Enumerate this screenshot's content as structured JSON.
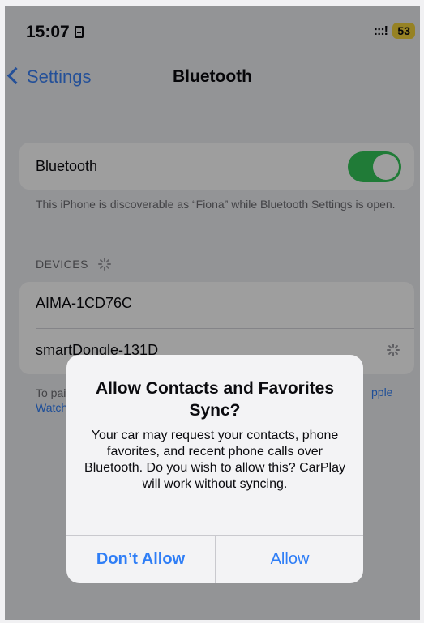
{
  "status_bar": {
    "time": "15:07",
    "signal": ":::!",
    "battery": "53"
  },
  "nav": {
    "back_label": "Settings",
    "title": "Bluetooth"
  },
  "bluetooth_group": {
    "toggle_label": "Bluetooth",
    "toggle_on": true,
    "discoverable_note": "This iPhone is discoverable as “Fiona” while Bluetooth Settings is open."
  },
  "devices": {
    "header": "DEVICES",
    "items": [
      {
        "name": "AIMA-1CD76C"
      },
      {
        "name": "smartDongle-131D"
      }
    ],
    "footer_left": "To pai",
    "footer_left_2": "Watch",
    "footer_right": "pple"
  },
  "alert": {
    "title": "Allow Contacts and Favorites Sync?",
    "message": "Your car may request your contacts, phone favorites, and recent phone calls over Bluetooth. Do you wish to allow this? CarPlay will work without syncing.",
    "deny_label": "Don’t Allow",
    "allow_label": "Allow"
  },
  "colors": {
    "accent": "#2f7ef6",
    "toggle_on": "#35c759",
    "battery": "#f2d23a"
  },
  "icons": [
    "sim-card-icon",
    "signal-icon",
    "chevron-left-icon",
    "loading-spinner-icon"
  ]
}
